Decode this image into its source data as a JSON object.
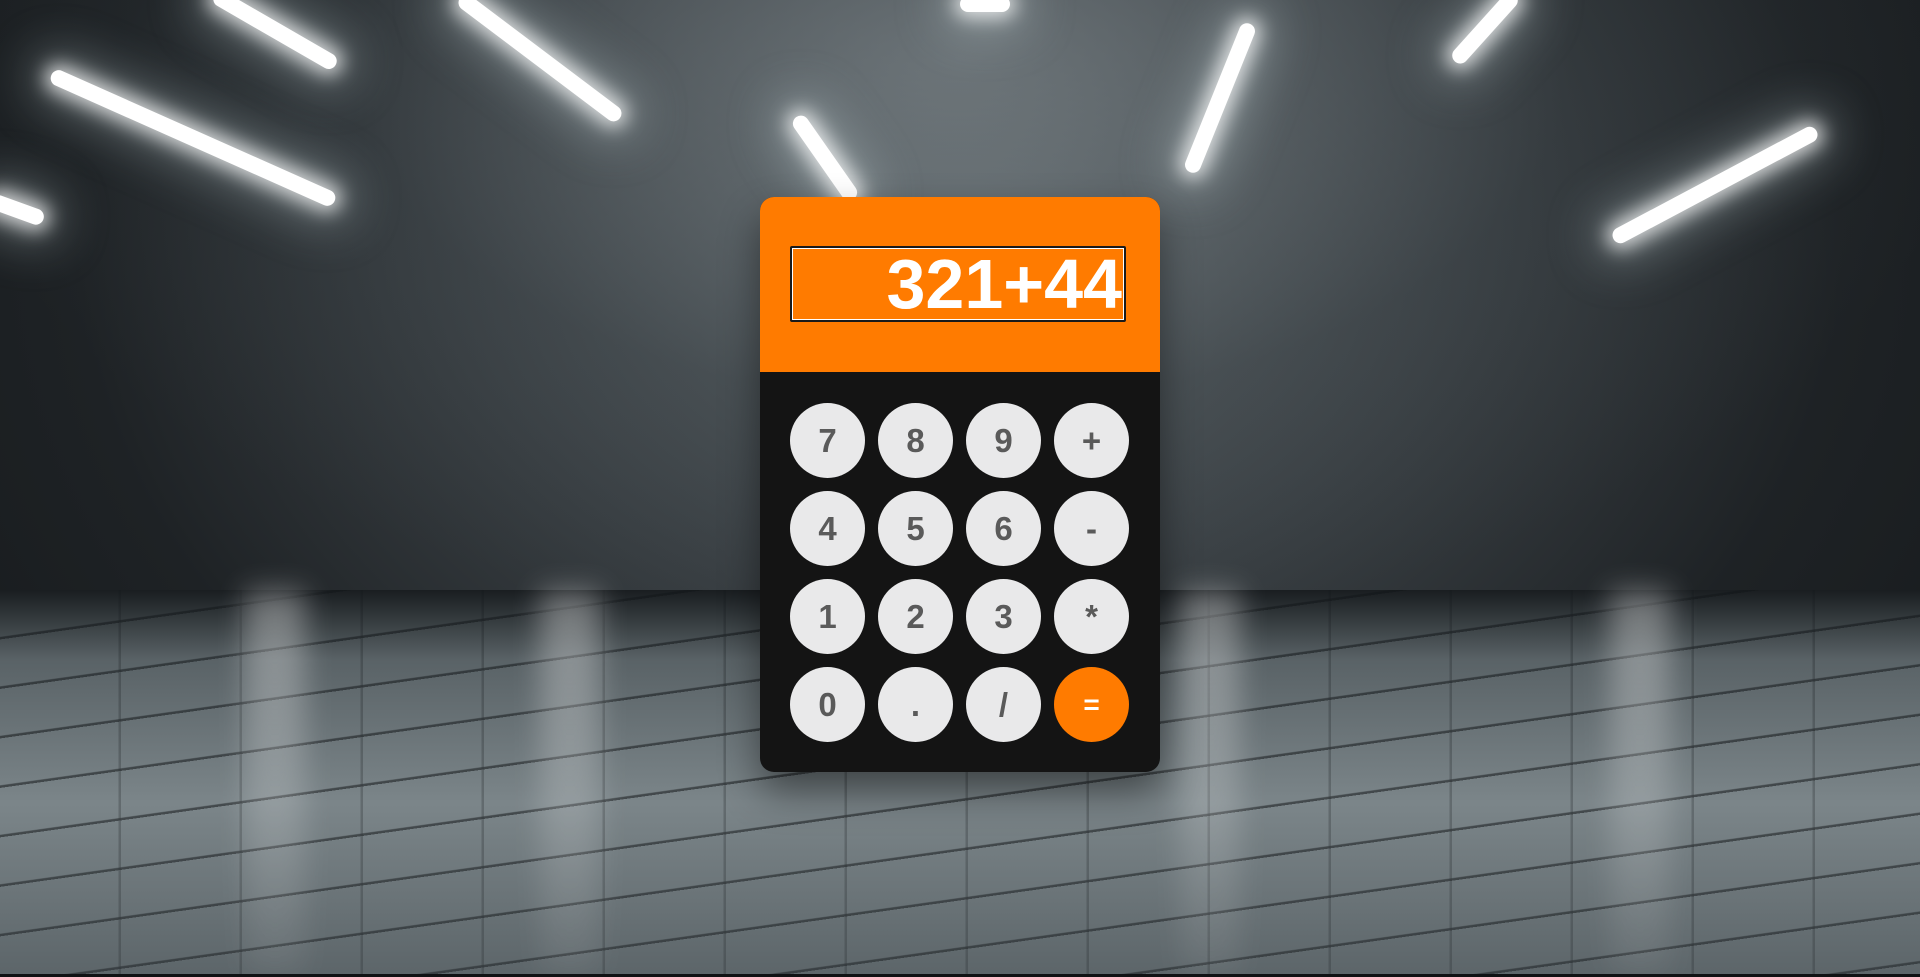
{
  "calculator": {
    "display_value": "321+44",
    "accent_color": "#ff7b00",
    "keys": [
      {
        "label": "7",
        "role": "digit"
      },
      {
        "label": "8",
        "role": "digit"
      },
      {
        "label": "9",
        "role": "digit"
      },
      {
        "label": "+",
        "role": "operator"
      },
      {
        "label": "4",
        "role": "digit"
      },
      {
        "label": "5",
        "role": "digit"
      },
      {
        "label": "6",
        "role": "digit"
      },
      {
        "label": "-",
        "role": "operator"
      },
      {
        "label": "1",
        "role": "digit"
      },
      {
        "label": "2",
        "role": "digit"
      },
      {
        "label": "3",
        "role": "digit"
      },
      {
        "label": "*",
        "role": "operator"
      },
      {
        "label": "0",
        "role": "digit"
      },
      {
        "label": ".",
        "role": "decimal"
      },
      {
        "label": "/",
        "role": "operator"
      },
      {
        "label": "=",
        "role": "equals"
      }
    ]
  }
}
